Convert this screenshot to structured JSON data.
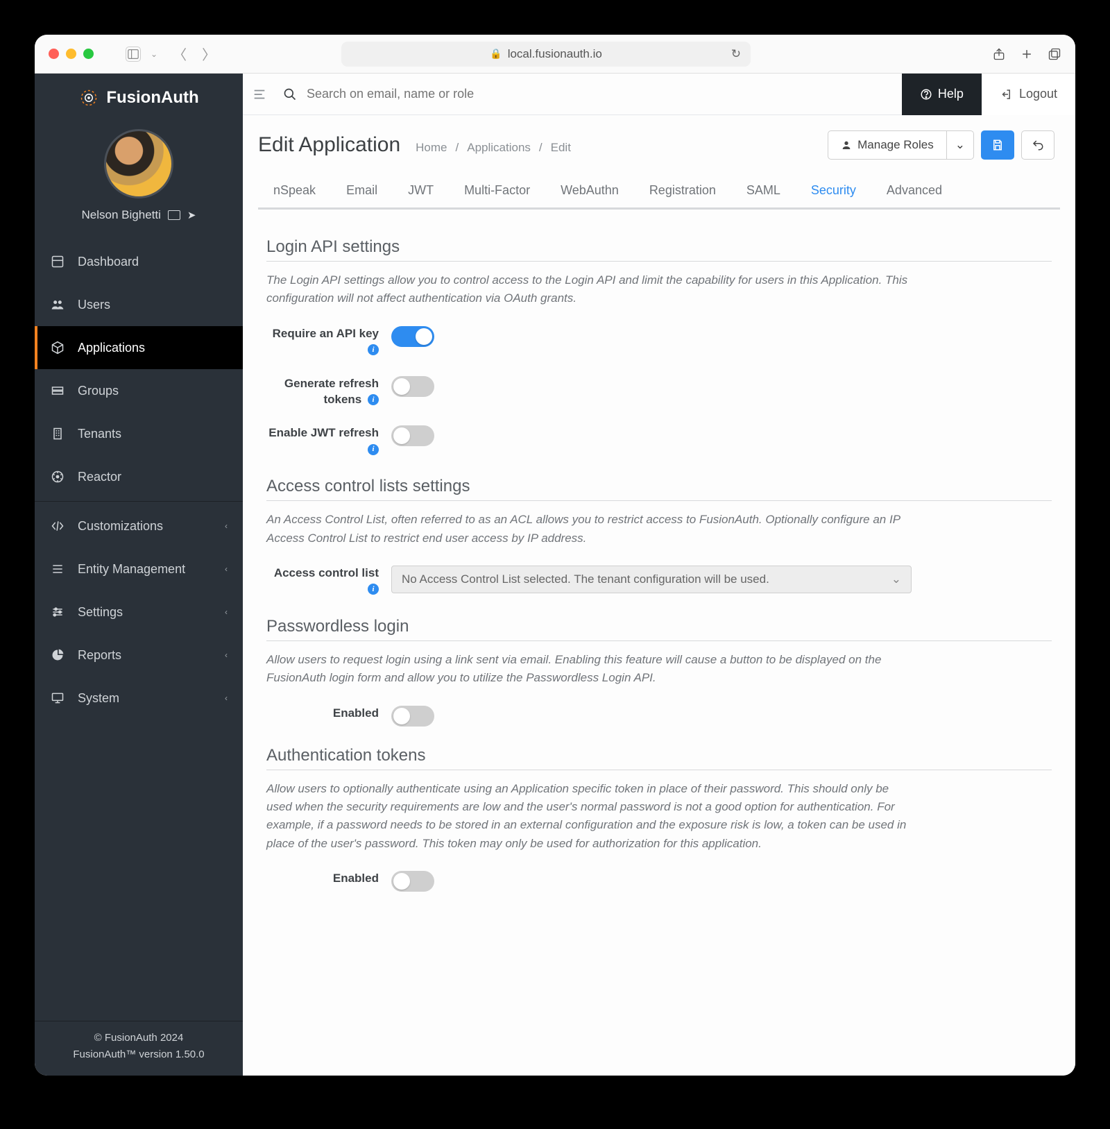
{
  "url": {
    "host": "local.fusionauth.io"
  },
  "brand": {
    "name": "FusionAuth"
  },
  "user": {
    "name": "Nelson Bighetti"
  },
  "sidebar": {
    "items": [
      {
        "label": "Dashboard",
        "icon": "dashboard"
      },
      {
        "label": "Users",
        "icon": "users"
      },
      {
        "label": "Applications",
        "icon": "cube",
        "active": true
      },
      {
        "label": "Groups",
        "icon": "group"
      },
      {
        "label": "Tenants",
        "icon": "building"
      },
      {
        "label": "Reactor",
        "icon": "reactor"
      },
      {
        "label": "Customizations",
        "icon": "code",
        "expandable": true
      },
      {
        "label": "Entity Management",
        "icon": "list",
        "expandable": true
      },
      {
        "label": "Settings",
        "icon": "sliders",
        "expandable": true
      },
      {
        "label": "Reports",
        "icon": "pie",
        "expandable": true
      },
      {
        "label": "System",
        "icon": "monitor",
        "expandable": true
      }
    ]
  },
  "footer": {
    "copyright": "© FusionAuth 2024",
    "version": "FusionAuth™ version 1.50.0"
  },
  "topbar": {
    "search_placeholder": "Search on email, name or role",
    "help": "Help",
    "logout": "Logout"
  },
  "page": {
    "title": "Edit Application",
    "crumbs": [
      "Home",
      "Applications",
      "Edit"
    ],
    "manage_roles": "Manage Roles"
  },
  "tabs": [
    "nSpeak",
    "Email",
    "JWT",
    "Multi-Factor",
    "WebAuthn",
    "Registration",
    "SAML",
    "Security",
    "Advanced"
  ],
  "active_tab": "Security",
  "sections": {
    "login_api": {
      "title": "Login API settings",
      "desc": "The Login API settings allow you to control access to the Login API and limit the capability for users in this Application. This configuration will not affect authentication via OAuth grants.",
      "require_api_key": {
        "label": "Require an API key",
        "on": true
      },
      "generate_refresh_tokens": {
        "label": "Generate refresh tokens",
        "on": false
      },
      "enable_jwt_refresh": {
        "label": "Enable JWT refresh",
        "on": false
      }
    },
    "acl": {
      "title": "Access control lists settings",
      "desc": "An Access Control List, often referred to as an ACL allows you to restrict access to FusionAuth. Optionally configure an IP Access Control List to restrict end user access by IP address.",
      "field_label": "Access control list",
      "select_value": "No Access Control List selected. The tenant configuration will be used."
    },
    "passwordless": {
      "title": "Passwordless login",
      "desc": "Allow users to request login using a link sent via email. Enabling this feature will cause a button to be displayed on the FusionAuth login form and allow you to utilize the Passwordless Login API.",
      "enabled": {
        "label": "Enabled",
        "on": false
      }
    },
    "auth_tokens": {
      "title": "Authentication tokens",
      "desc": "Allow users to optionally authenticate using an Application specific token in place of their password. This should only be used when the security requirements are low and the user's normal password is not a good option for authentication. For example, if a password needs to be stored in an external configuration and the exposure risk is low, a token can be used in place of the user's password. This token may only be used for authorization for this application.",
      "enabled": {
        "label": "Enabled",
        "on": false
      }
    }
  }
}
